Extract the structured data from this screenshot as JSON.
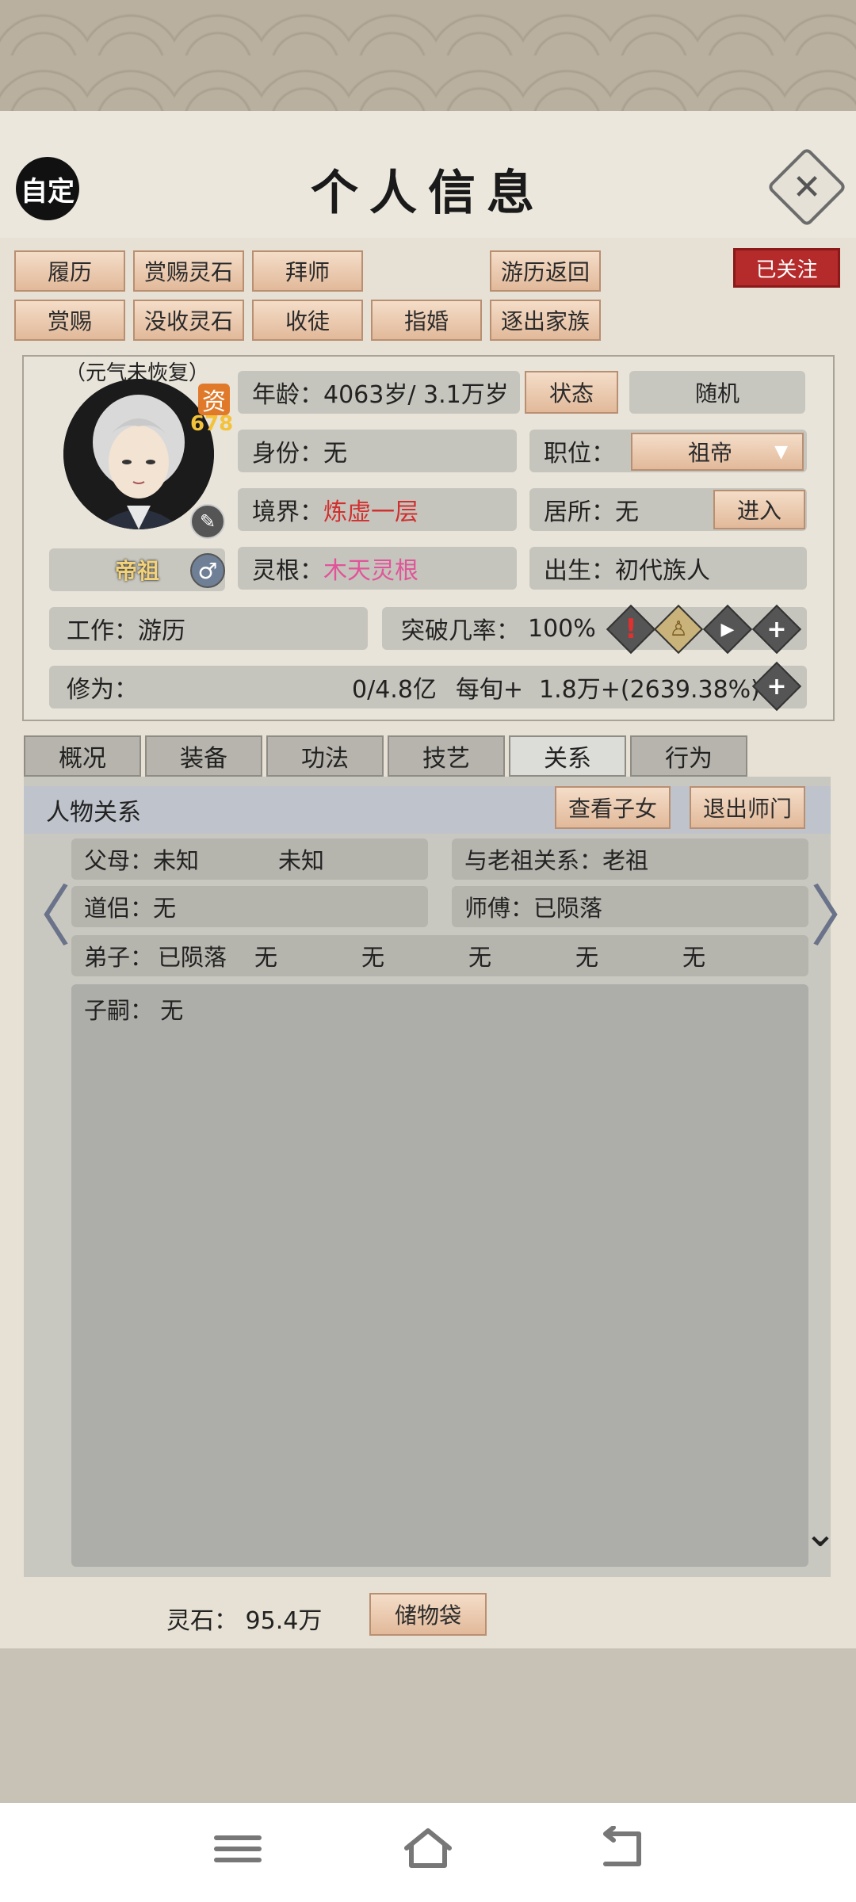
{
  "header": {
    "title": "个人信息",
    "left_button": "自定",
    "close_icon": "close-icon"
  },
  "actions": {
    "row1": [
      "履历",
      "赏赐灵石",
      "拜师",
      "游历返回"
    ],
    "row2": [
      "赏赐",
      "没收灵石",
      "收徒",
      "指婚",
      "逐出家族"
    ],
    "follow": "已关注"
  },
  "character": {
    "condition": "（元气未恢复）",
    "aptitude_label": "资",
    "aptitude_value": "678",
    "title_badge": "帝祖",
    "gender_symbol": "♂",
    "age_label": "年龄：",
    "age_value": "4063岁/ 3.1万岁",
    "status_button": "状态",
    "random_button": "随机",
    "identity_label": "身份：",
    "identity_value": "无",
    "position_label": "职位：",
    "position_value": "祖帝",
    "realm_label": "境界：",
    "realm_value": "炼虚一层",
    "residence_label": "居所：",
    "residence_value": "无",
    "enter_button": "进入",
    "root_label": "灵根：",
    "root_value": "木天灵根",
    "birth_label": "出生：",
    "birth_value": "初代族人",
    "work_label": "工作：",
    "work_value": "游历",
    "breakthrough_label": "突破几率：",
    "breakthrough_value": "100%",
    "cultivation_label": "修为：",
    "cultivation_value": "0/4.8亿",
    "per_period_label": "每旬+",
    "per_period_value": "1.8万+(2639.38%)"
  },
  "tabs": [
    "概况",
    "装备",
    "功法",
    "技艺",
    "关系",
    "行为"
  ],
  "active_tab": "关系",
  "relations": {
    "section_title": "人物关系",
    "view_children_button": "查看子女",
    "leave_master_button": "退出师门",
    "parents_label": "父母：",
    "parent1": "未知",
    "parent2": "未知",
    "ancestor_relation_label": "与老祖关系：",
    "ancestor_relation_value": "老祖",
    "partner_label": "道侣：",
    "partner_value": "无",
    "master_label": "师傅：",
    "master_value": "已陨落",
    "disciples_label": "弟子：",
    "disciples": [
      "已陨落",
      "无",
      "无",
      "无",
      "无",
      "无"
    ],
    "heirs_label": "子嗣：",
    "heirs_value": "无"
  },
  "footer": {
    "spirit_stone_label": "灵石：",
    "spirit_stone_value": "95.4万",
    "storage_button": "储物袋"
  },
  "colors": {
    "accent_red": "#d03030",
    "root_pink": "#e05599",
    "follow_red": "#b52a2a",
    "button_peach": "#e8c3a5"
  }
}
